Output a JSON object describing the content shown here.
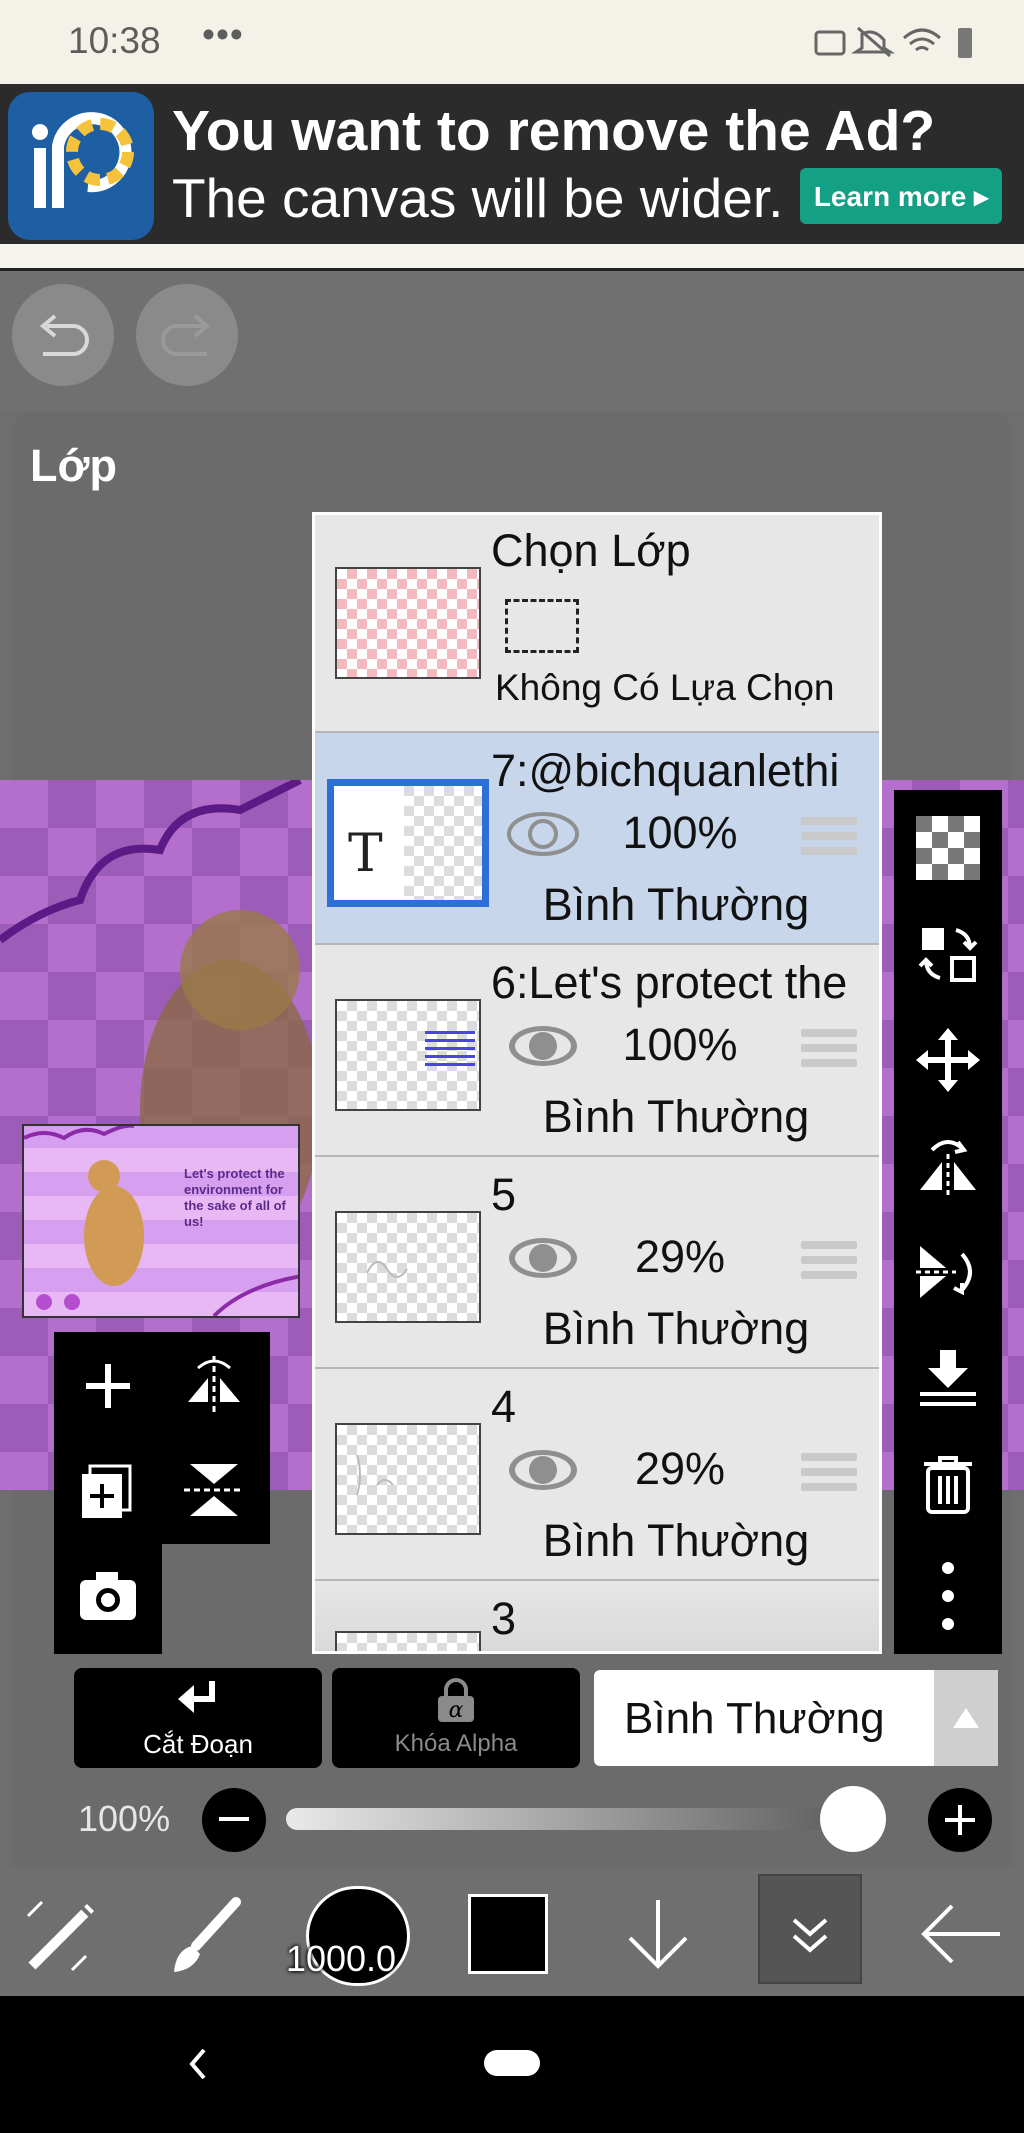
{
  "status": {
    "time": "10:38",
    "dots": "•••"
  },
  "ad": {
    "headline": "You want to remove the Ad?",
    "subline": "The canvas will be wider.",
    "button": "Learn more ▸"
  },
  "panel": {
    "title": "Lớp"
  },
  "thumb_text": "Let's protect the environment for the sake of all of us!",
  "selection_row": {
    "title": "Chọn Lớp",
    "subtitle": "Không Có Lựa Chọn"
  },
  "layers": [
    {
      "name": "7:@bichquanlethi",
      "opacity": "100%",
      "blend": "Bình Thường",
      "type_glyph": "T"
    },
    {
      "name": "6:Let's protect the",
      "opacity": "100%",
      "blend": "Bình Thường"
    },
    {
      "name": "5",
      "opacity": "29%",
      "blend": "Bình Thường"
    },
    {
      "name": "4",
      "opacity": "29%",
      "blend": "Bình Thường"
    },
    {
      "name": "3"
    }
  ],
  "controls": {
    "clip_label": "Cắt Đoạn",
    "alpha_label": "Khóa Alpha",
    "blend_mode": "Bình Thường",
    "opacity_value": "100%",
    "opacity_level": 1.0
  },
  "bottom": {
    "brush_size": "1000.0"
  },
  "colors": {
    "selected_row": "#c8d6ec",
    "accent_blue": "#2c6fd6",
    "ad_button": "#14a085"
  }
}
